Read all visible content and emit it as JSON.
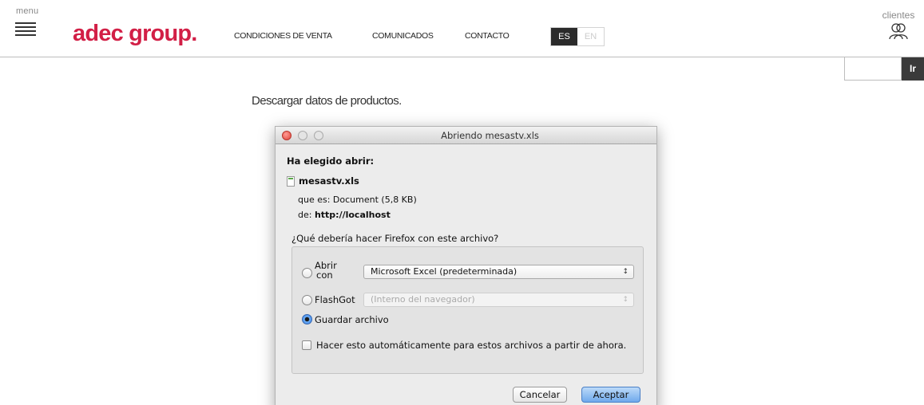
{
  "header": {
    "menu_label": "menu",
    "logo": "adec group.",
    "nav": [
      "CONDICIONES DE VENTA",
      "COMUNICADOS",
      "CONTACTO"
    ],
    "lang_active": "ES",
    "lang_inactive": "EN",
    "clientes_label": "clientes",
    "search_button": "Ir",
    "search_value": ""
  },
  "page": {
    "title": "Descargar datos de productos."
  },
  "dialog": {
    "title": "Abriendo mesastv.xls",
    "heading": "Ha elegido abrir:",
    "file_name": "mesastv.xls",
    "type_line": "que es: Document (5,8 KB)",
    "from_prefix": "de: ",
    "from_host": "http://localhost",
    "question": "¿Qué debería hacer Firefox con este archivo?",
    "open_with_label_1": "Abrir",
    "open_with_label_2": "con",
    "open_with_app": "Microsoft Excel (predeterminada)",
    "flashgot_label": "FlashGot",
    "flashgot_value": "(Interno del navegador)",
    "save_label": "Guardar archivo",
    "auto_label": "Hacer esto automáticamente para estos archivos a partir de ahora.",
    "cancel_label": "Cancelar",
    "ok_label": "Aceptar",
    "arrows": "↕"
  },
  "colors": {
    "brand": "#d21f46",
    "lang_active_bg": "#2b2b2b",
    "accept_button": "#6fa9ec"
  },
  "icons": [
    "hamburger-icon",
    "clientes-people-icon",
    "file-icon",
    "close-window-icon",
    "minimize-window-icon",
    "maximize-window-icon"
  ]
}
